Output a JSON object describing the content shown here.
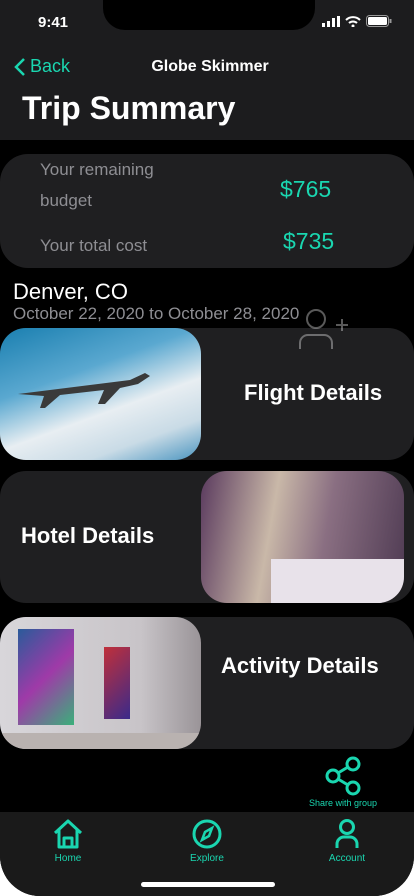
{
  "status_bar": {
    "time": "9:41"
  },
  "nav": {
    "back_label": "Back",
    "app_title": "Globe Skimmer",
    "page_title": "Trip Summary"
  },
  "budget": {
    "remaining_label_1": "Your remaining",
    "remaining_label_2": "budget",
    "remaining_value": "$765",
    "total_label": "Your total cost",
    "total_value": "$735"
  },
  "trip": {
    "city": "Denver, CO",
    "dates": "October 22, 2020 to October 28, 2020"
  },
  "cards": [
    {
      "label": "Flight Details"
    },
    {
      "label": "Hotel Details"
    },
    {
      "label": "Activity Details"
    }
  ],
  "share": {
    "label": "Share with group"
  },
  "tabs": [
    {
      "label": "Home"
    },
    {
      "label": "Explore"
    },
    {
      "label": "Account"
    }
  ],
  "colors": {
    "accent": "#1ad6b0"
  }
}
